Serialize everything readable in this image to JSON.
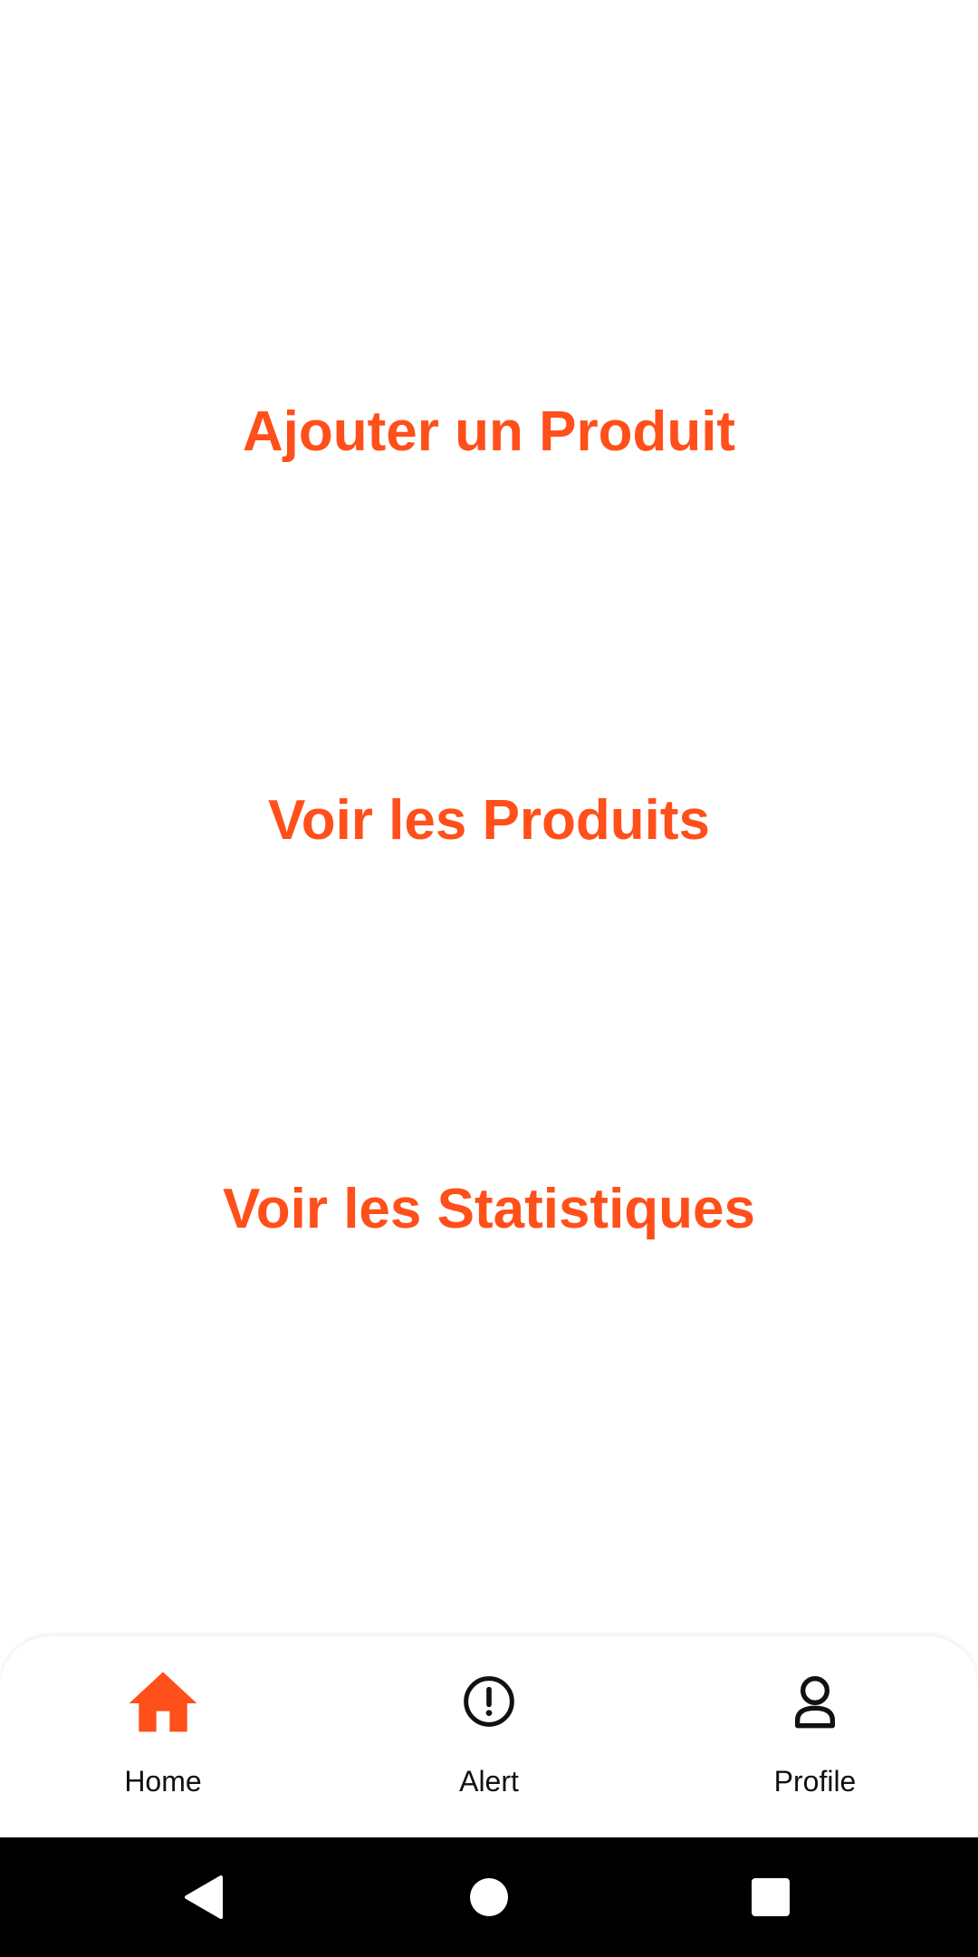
{
  "menu": {
    "items": [
      {
        "label": "Ajouter un Produit"
      },
      {
        "label": "Voir les Produits"
      },
      {
        "label": "Voir les Statistiques"
      }
    ]
  },
  "bottom_nav": {
    "items": [
      {
        "label": "Home",
        "icon": "home-icon",
        "active": true
      },
      {
        "label": "Alert",
        "icon": "alert-circle-icon",
        "active": false
      },
      {
        "label": "Profile",
        "icon": "user-icon",
        "active": false
      }
    ]
  },
  "system_nav": {
    "buttons": [
      {
        "icon": "back-triangle-icon"
      },
      {
        "icon": "home-circle-icon"
      },
      {
        "icon": "recents-square-icon"
      }
    ]
  },
  "colors": {
    "accent": "#FF4F1A",
    "background": "#FFFFFF",
    "nav_text": "#111111",
    "system_bar": "#000000"
  }
}
